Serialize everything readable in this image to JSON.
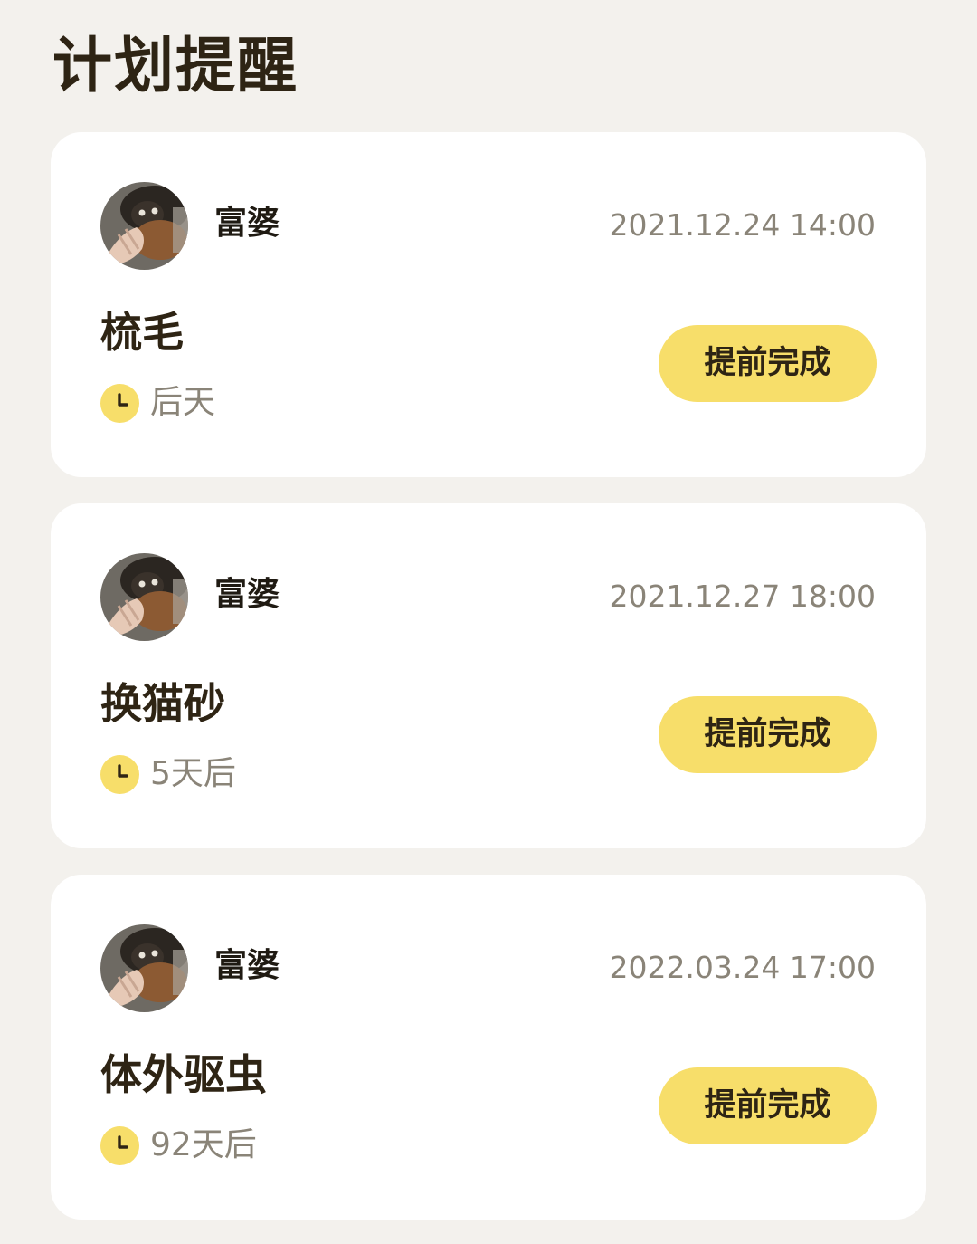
{
  "header": {
    "title": "计划提醒"
  },
  "reminders": [
    {
      "owner": "富婆",
      "datetime": "2021.12.24 14:00",
      "task": "梳毛",
      "due": "后天",
      "button_label": "提前完成"
    },
    {
      "owner": "富婆",
      "datetime": "2021.12.27 18:00",
      "task": "换猫砂",
      "due": "5天后",
      "button_label": "提前完成"
    },
    {
      "owner": "富婆",
      "datetime": "2022.03.24 17:00",
      "task": "体外驱虫",
      "due": "92天后",
      "button_label": "提前完成"
    }
  ],
  "icons": {
    "due": "clock-icon",
    "avatar": "cat-photo-avatar"
  },
  "colors": {
    "background": "#f3f1ed",
    "card": "#ffffff",
    "accent_yellow": "#f7de6a",
    "title_text": "#2e2414",
    "secondary_text": "#8a8478"
  }
}
